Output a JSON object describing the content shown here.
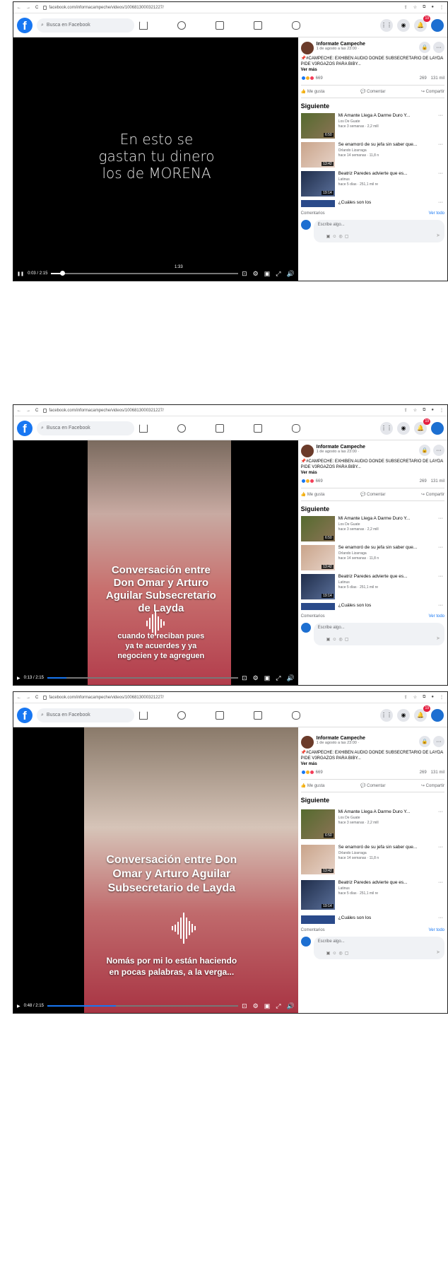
{
  "browser": {
    "url": "facebook.com/informacampeche/videos/1006813000321227/"
  },
  "header": {
    "search_placeholder": "Busca en Facebook",
    "notifications": "19"
  },
  "post": {
    "page_name": "Informate Campeche",
    "date": "1 de agosto a las 23:00 · ",
    "text": "📌#CAMPECHE: EXHIBEN AUDIO DONDE SUBSECRETARIO DE LAYDA PIDE V3RGAZOS PARA BIBY...",
    "more": "Ver más",
    "reactions": "669",
    "comments": "269",
    "views": "131 mil",
    "like": "Me gusta",
    "comment": "Comentar",
    "share": "Compartir"
  },
  "sidebar": {
    "title": "Siguiente",
    "items": [
      {
        "title": "Mi Amante Llega A Darme Duro Y...",
        "channel": "Los De Guate",
        "meta": "hace 3 semanas · 2,2 mill",
        "duration": "6:50"
      },
      {
        "title": "Se enamoró de su jefa sin saber que...",
        "channel": "Orlando Lizarraga",
        "meta": "hace 14 semanas · 11,8 n",
        "duration": "13:42"
      },
      {
        "title": "Beatriz Paredes advierte que es...",
        "channel": "Latinus",
        "meta": "hace 5 días · 251,1 mil re",
        "duration": "19:14"
      },
      {
        "title": "¿Cuáles son los",
        "channel": "",
        "meta": "",
        "duration": ""
      }
    ],
    "comments_label": "Comentarios",
    "view_all": "Ver todo",
    "write_placeholder": "Escribe algo..."
  },
  "frames": [
    {
      "caption": "En esto se gastan tu dinero los de MORENA",
      "time": "0:03 / 2:15",
      "center_time": "1:33",
      "progress": 0.06
    },
    {
      "title": "Conversación entre Don Omar y Arturo Aguilar Subsecretario de Layda",
      "subtitle": "cuando te reciban pues ya te acuerdes y ya negocien y te agreguen",
      "time": "0:13 / 2:15",
      "progress": 0.1
    },
    {
      "title": "Conversación entre Don Omar y Arturo Aguilar Subsecretario de Layda",
      "subtitle": "Nomás por mi lo están haciendo en pocas palabras, a la verga...",
      "time": "0:48 / 2:15",
      "progress": 0.36
    }
  ]
}
